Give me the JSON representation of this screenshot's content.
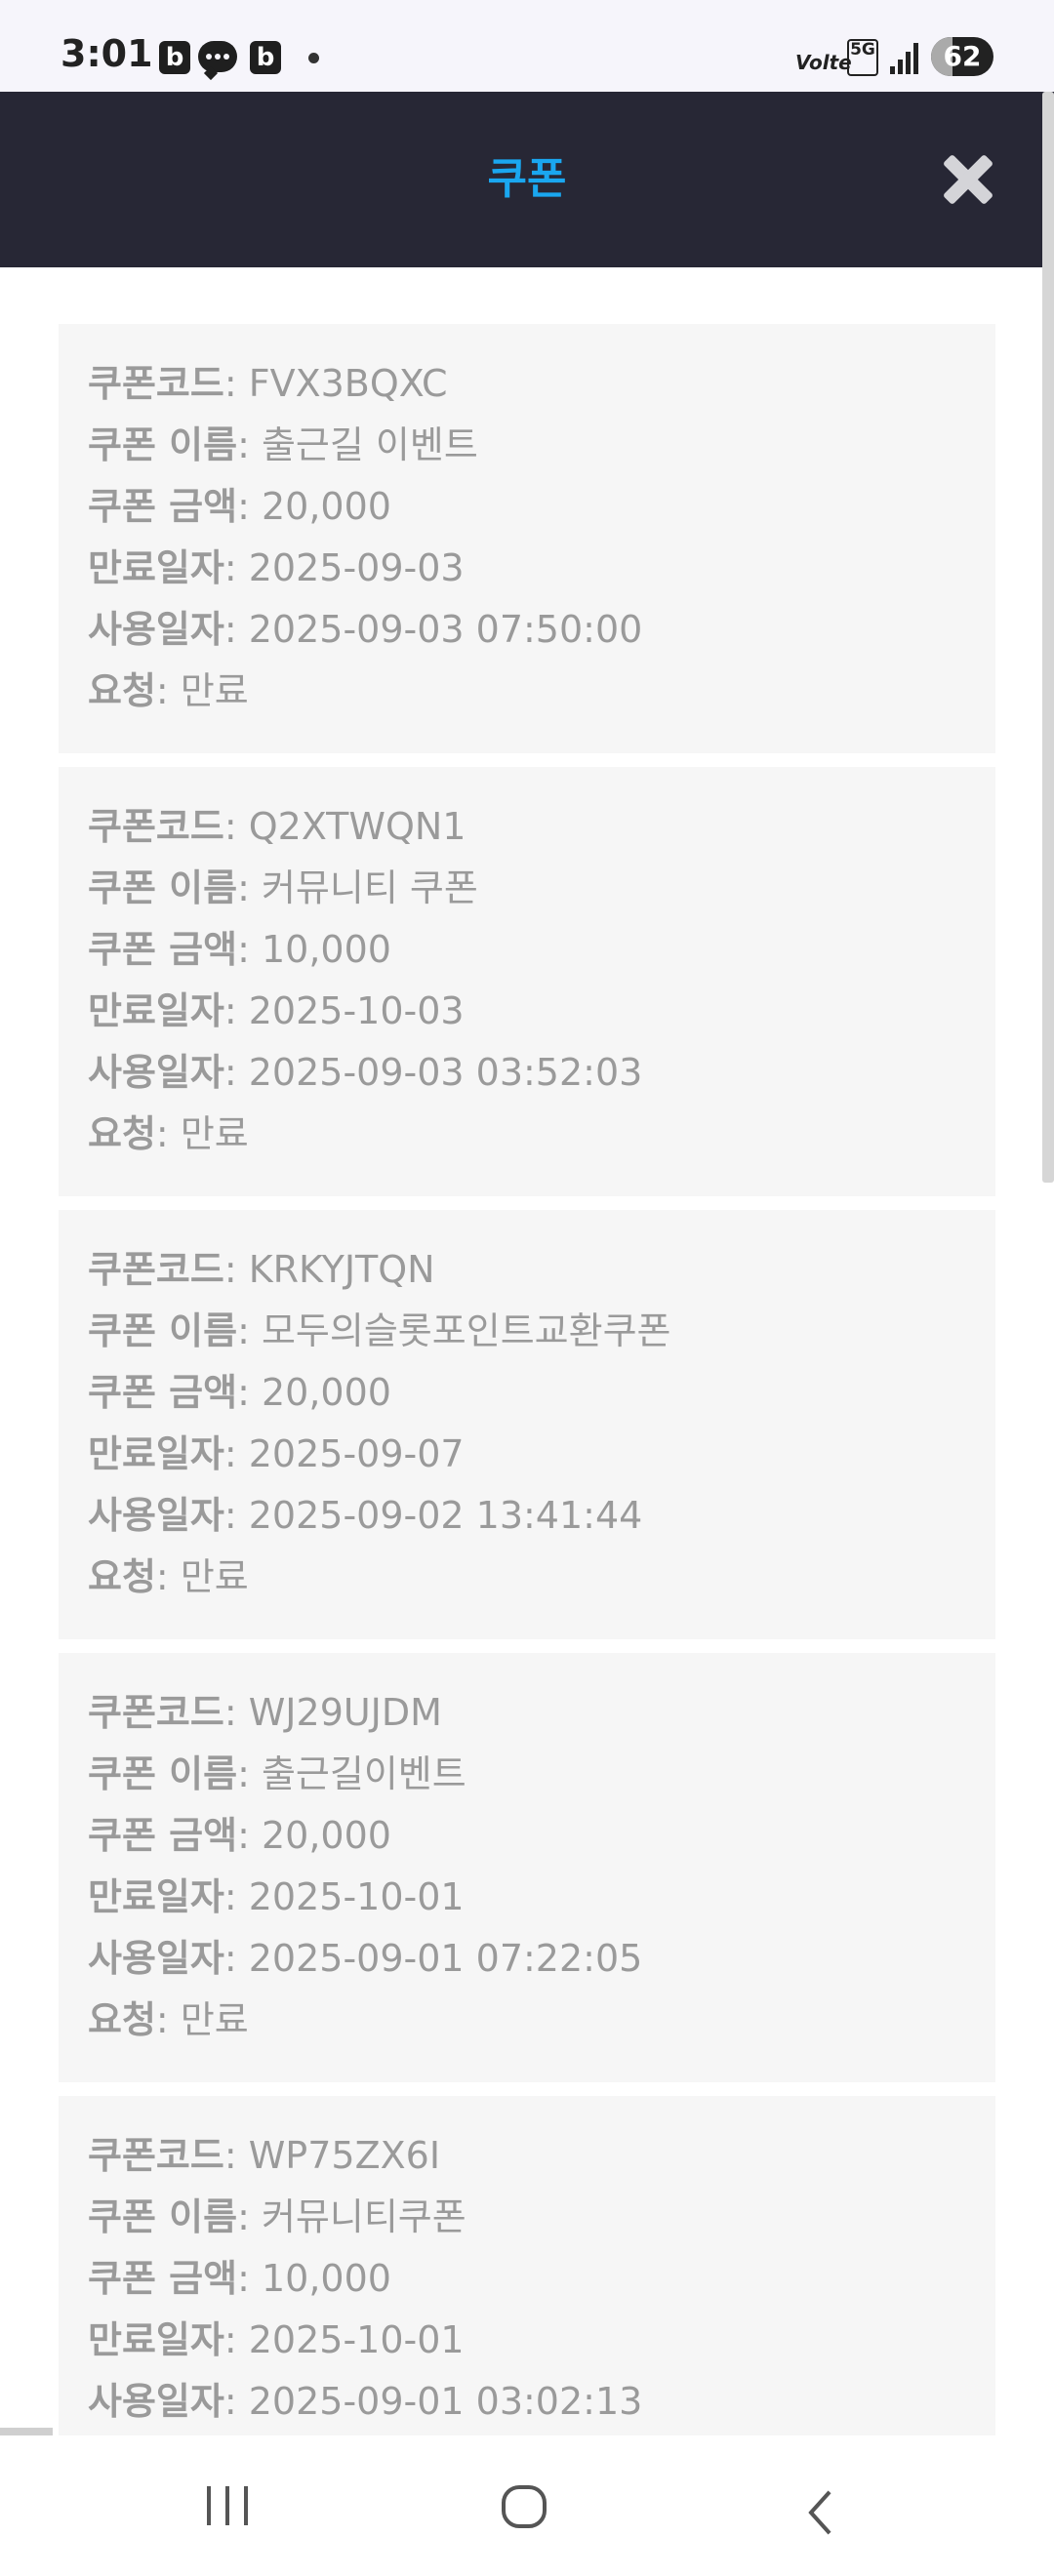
{
  "status_bar": {
    "time": "3:01",
    "app_icon_letter": "b",
    "network_label": "Volte",
    "network_type": "5G",
    "battery": "62"
  },
  "header": {
    "title": "쿠폰",
    "close_icon": "close-icon"
  },
  "coupons": [
    {
      "code_label": "쿠폰코드",
      "code": "FVX3BQXC",
      "name_label": "쿠폰 이름",
      "name": "출근길 이벤트",
      "amount_label": "쿠폰 금액",
      "amount": "20,000",
      "expiry_label": "만료일자",
      "expiry": "2025-09-03",
      "used_label": "사용일자",
      "used": "2025-09-03 07:50:00",
      "request_label": "요청",
      "request": "만료"
    },
    {
      "code_label": "쿠폰코드",
      "code": "Q2XTWQN1",
      "name_label": "쿠폰 이름",
      "name": "커뮤니티 쿠폰",
      "amount_label": "쿠폰 금액",
      "amount": "10,000",
      "expiry_label": "만료일자",
      "expiry": "2025-10-03",
      "used_label": "사용일자",
      "used": "2025-09-03 03:52:03",
      "request_label": "요청",
      "request": "만료"
    },
    {
      "code_label": "쿠폰코드",
      "code": "KRKYJTQN",
      "name_label": "쿠폰 이름",
      "name": "모두의슬롯포인트교환쿠폰",
      "amount_label": "쿠폰 금액",
      "amount": "20,000",
      "expiry_label": "만료일자",
      "expiry": "2025-09-07",
      "used_label": "사용일자",
      "used": "2025-09-02 13:41:44",
      "request_label": "요청",
      "request": "만료"
    },
    {
      "code_label": "쿠폰코드",
      "code": "WJ29UJDM",
      "name_label": "쿠폰 이름",
      "name": "출근길이벤트",
      "amount_label": "쿠폰 금액",
      "amount": "20,000",
      "expiry_label": "만료일자",
      "expiry": "2025-10-01",
      "used_label": "사용일자",
      "used": "2025-09-01 07:22:05",
      "request_label": "요청",
      "request": "만료"
    },
    {
      "code_label": "쿠폰코드",
      "code": "WP75ZX6I",
      "name_label": "쿠폰 이름",
      "name": "커뮤니티쿠폰",
      "amount_label": "쿠폰 금액",
      "amount": "10,000",
      "expiry_label": "만료일자",
      "expiry": "2025-10-01",
      "used_label": "사용일자",
      "used": "2025-09-01 03:02:13"
    }
  ],
  "nav_bar": {
    "recent_icon": "recent-apps-icon",
    "home_icon": "home-icon",
    "back_icon": "back-icon"
  }
}
